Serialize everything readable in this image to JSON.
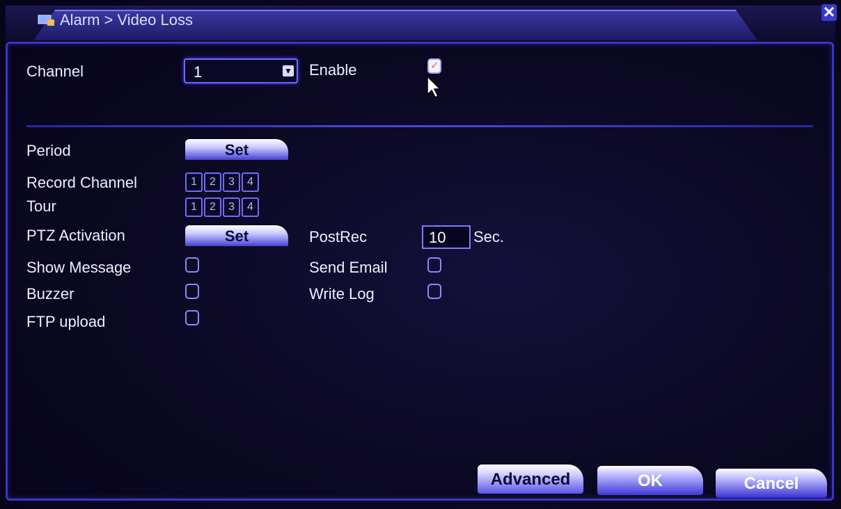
{
  "window": {
    "title": "Alarm > Video Loss"
  },
  "form": {
    "channel": {
      "label": "Channel",
      "value": "1"
    },
    "enable": {
      "label": "Enable",
      "checked": true
    },
    "period": {
      "label": "Period",
      "button": "Set"
    },
    "record_channel": {
      "label": "Record Channel",
      "channels": [
        "1",
        "2",
        "3",
        "4"
      ]
    },
    "tour": {
      "label": "Tour",
      "channels": [
        "1",
        "2",
        "3",
        "4"
      ]
    },
    "ptz_activation": {
      "label": "PTZ Activation",
      "button": "Set"
    },
    "postrec": {
      "label": "PostRec",
      "value": "10",
      "unit": "Sec."
    },
    "show_message": {
      "label": "Show Message",
      "checked": false
    },
    "send_email": {
      "label": "Send Email",
      "checked": false
    },
    "buzzer": {
      "label": "Buzzer",
      "checked": false
    },
    "write_log": {
      "label": "Write Log",
      "checked": false
    },
    "ftp_upload": {
      "label": "FTP upload",
      "checked": false
    }
  },
  "buttons": {
    "advanced": "Advanced",
    "ok": "OK",
    "cancel": "Cancel"
  },
  "icons": {
    "close": "close-icon",
    "title": "alarm-window-icon",
    "dropdown": "chevron-down-icon",
    "cursor": "mouse-pointer-icon"
  },
  "colors": {
    "accent": "#4b48e4",
    "background": "#0b0822",
    "check_mark": "#e06060"
  }
}
